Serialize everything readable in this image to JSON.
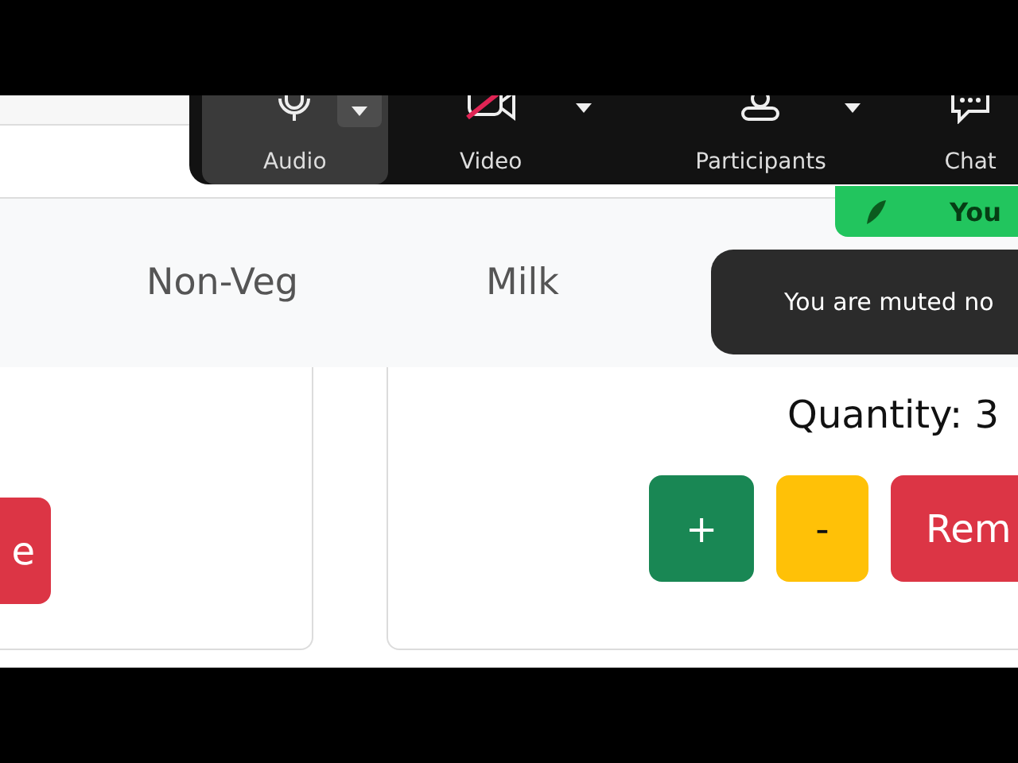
{
  "toolbar": {
    "items": [
      {
        "kind": "audio",
        "label": "Audio",
        "selected": true,
        "has_menu": true
      },
      {
        "kind": "video",
        "label": "Video",
        "selected": false,
        "has_menu": true
      },
      {
        "kind": "participants",
        "label": "Participants",
        "selected": false,
        "has_menu": true
      },
      {
        "kind": "chat",
        "label": "Chat",
        "selected": false,
        "has_menu": false
      }
    ]
  },
  "speaker_badge": {
    "label": "You"
  },
  "toast": {
    "text": "You are muted no"
  },
  "nav": {
    "items": [
      {
        "label": "Non-Veg"
      },
      {
        "label": "Milk"
      }
    ]
  },
  "cards": [
    {
      "buttons": [
        {
          "kind": "remove",
          "label": "e"
        }
      ]
    },
    {
      "quantity": "Quantity: 3",
      "buttons": [
        {
          "kind": "increase",
          "label": "+"
        },
        {
          "kind": "decrease",
          "label": "-"
        },
        {
          "kind": "remove",
          "label": "Rem"
        }
      ]
    }
  ]
}
